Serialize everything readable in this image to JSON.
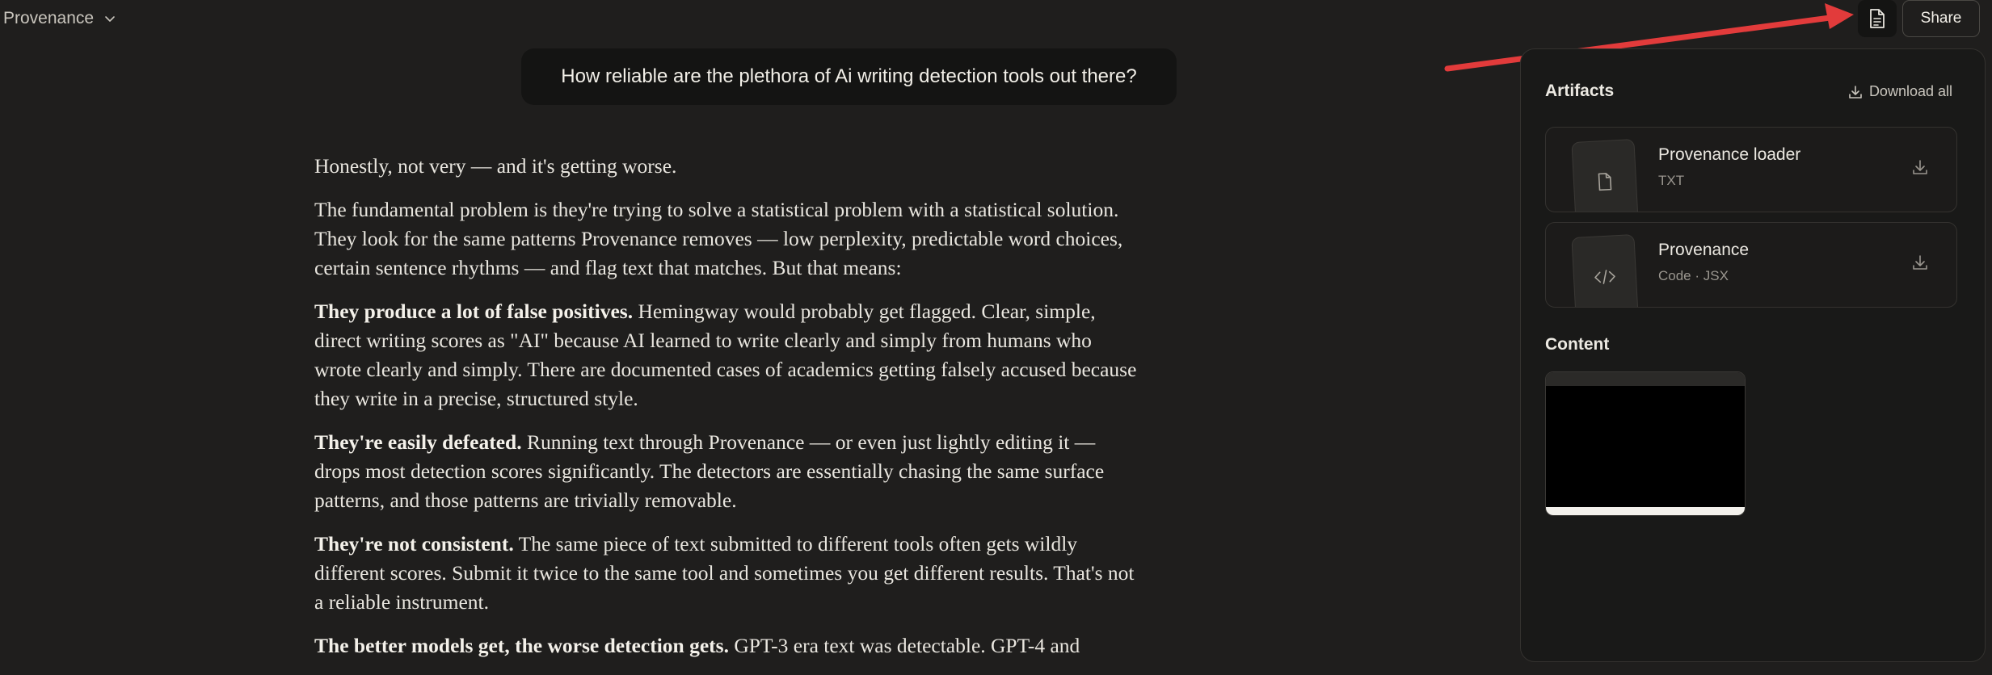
{
  "topbar": {
    "title": "Provenance",
    "share_label": "Share"
  },
  "conversation": {
    "user_message": "How reliable are the plethora of Ai writing detection tools out there?",
    "reply": [
      {
        "bold": "",
        "text": "Honestly, not very — and it's getting worse."
      },
      {
        "bold": "",
        "text": "The fundamental problem is they're trying to solve a statistical problem with a statistical solution. They look for the same patterns Provenance removes — low perplexity, predictable word choices, certain sentence rhythms — and flag text that matches. But that means:"
      },
      {
        "bold": "They produce a lot of false positives.",
        "text": " Hemingway would probably get flagged. Clear, simple, direct writing scores as \"AI\" because AI learned to write clearly and simply from humans who wrote clearly and simply. There are documented cases of academics getting falsely accused because they write in a precise, structured style."
      },
      {
        "bold": "They're easily defeated.",
        "text": " Running text through Provenance — or even just lightly editing it — drops most detection scores significantly. The detectors are essentially chasing the same surface patterns, and those patterns are trivially removable."
      },
      {
        "bold": "They're not consistent.",
        "text": " The same piece of text submitted to different tools often gets wildly different scores. Submit it twice to the same tool and sometimes you get different results. That's not a reliable instrument."
      },
      {
        "bold": "The better models get, the worse detection gets.",
        "text": " GPT-3 era text was detectable. GPT-4 and"
      }
    ]
  },
  "artifacts_panel": {
    "title": "Artifacts",
    "download_all_label": "Download all",
    "items": [
      {
        "name": "Provenance loader",
        "subtitle": "TXT",
        "icon": "document-icon"
      },
      {
        "name": "Provenance",
        "subtitle": "Code · JSX",
        "icon": "code-icon"
      }
    ],
    "content_title": "Content"
  },
  "colors": {
    "background": "#1f1e1d",
    "panel": "#191918",
    "bubble": "#141413",
    "annotation_arrow": "#e23b3b"
  }
}
